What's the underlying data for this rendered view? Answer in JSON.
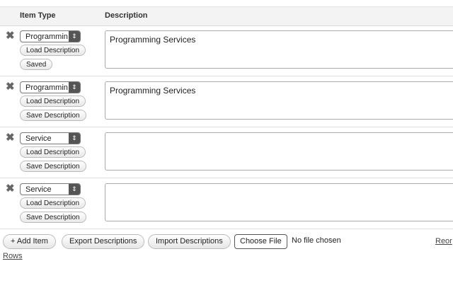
{
  "header": {
    "item_type": "Item Type",
    "description": "Description"
  },
  "rows": [
    {
      "type": "Programming Services",
      "desc": "Programming Services",
      "btn1": "Load Description",
      "btn2": "Saved"
    },
    {
      "type": "Programming Services",
      "desc": "Programming Services",
      "btn1": "Load Description",
      "btn2": "Save Description"
    },
    {
      "type": "Service",
      "desc": "",
      "btn1": "Load Description",
      "btn2": "Save Description"
    },
    {
      "type": "Service",
      "desc": "",
      "btn1": "Load Description",
      "btn2": "Save Description"
    }
  ],
  "footer": {
    "add": "+ Add Item",
    "export": "Export Descriptions",
    "import": "Import Descriptions",
    "choose": "Choose File",
    "no_file": "No file chosen",
    "reorder": "Reor",
    "rows": "Rows"
  },
  "icons": {
    "remove": "✖",
    "select_arrow": "⇕"
  }
}
